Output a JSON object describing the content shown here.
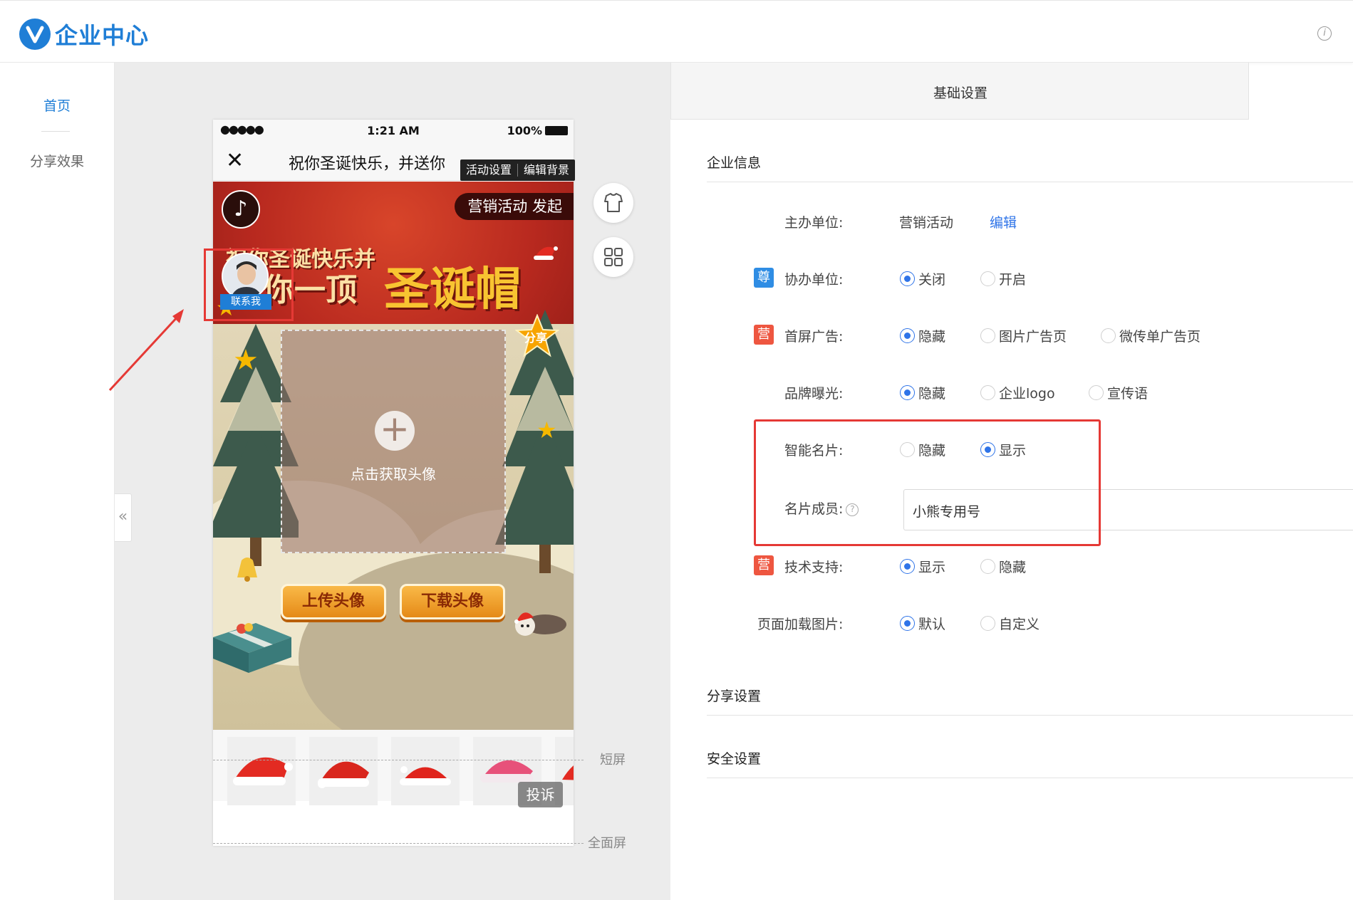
{
  "header": {
    "app_title": "企业中心"
  },
  "sidenav": {
    "items": [
      {
        "label": "首页",
        "active": true
      },
      {
        "label": "分享效果",
        "active": false
      }
    ]
  },
  "phone": {
    "status": {
      "signal": "●●●●●",
      "time": "1:21 AM",
      "battery": "100%"
    },
    "page_title": "祝你圣诞快乐，并送你",
    "toolbar": {
      "activity_settings": "活动设置",
      "edit_background": "编辑背景"
    },
    "poster": {
      "organizer_badge": "营销活动 发起",
      "headline_line1": "祝你圣诞快乐并",
      "headline_line2": "你一顶",
      "headline_big": "圣诞帽",
      "contact_label": "联系我",
      "upload_hint": "点击获取头像",
      "share_label": "分享",
      "btn_upload": "上传头像",
      "btn_download": "下载头像"
    },
    "complain": "投诉",
    "hat_count": 5
  },
  "screen_labels": {
    "short": "短屏",
    "full": "全面屏"
  },
  "settings": {
    "tab": "基础设置",
    "sections": {
      "enterprise_info": "企业信息",
      "share_settings": "分享设置",
      "security_settings": "安全设置"
    },
    "rows": {
      "host": {
        "label": "主办单位:",
        "value": "营销活动",
        "link": "编辑"
      },
      "co_host": {
        "tag": "尊",
        "label": "协办单位:",
        "options": [
          "关闭",
          "开启"
        ],
        "selected": 0
      },
      "splash_ad": {
        "tag": "营",
        "label": "首屏广告:",
        "options": [
          "隐藏",
          "图片广告页",
          "微传单广告页"
        ],
        "selected": 0
      },
      "brand": {
        "label": "品牌曝光:",
        "options": [
          "隐藏",
          "企业logo",
          "宣传语"
        ],
        "selected": 0
      },
      "smart_card": {
        "label": "智能名片:",
        "options": [
          "隐藏",
          "显示"
        ],
        "selected": 1
      },
      "card_member": {
        "label": "名片成员:",
        "help": "?",
        "value": "小熊专用号"
      },
      "tech_support": {
        "tag": "营",
        "label": "技术支持:",
        "options": [
          "显示",
          "隐藏"
        ],
        "selected": 0
      },
      "loading_image": {
        "label": "页面加载图片:",
        "options": [
          "默认",
          "自定义"
        ],
        "selected": 0
      }
    }
  },
  "colors": {
    "accent": "#1f7ed6",
    "radio": "#2f74e8",
    "annotation": "#e53935",
    "tag_red": "#ee5640",
    "tag_blue": "#2f8de4"
  }
}
